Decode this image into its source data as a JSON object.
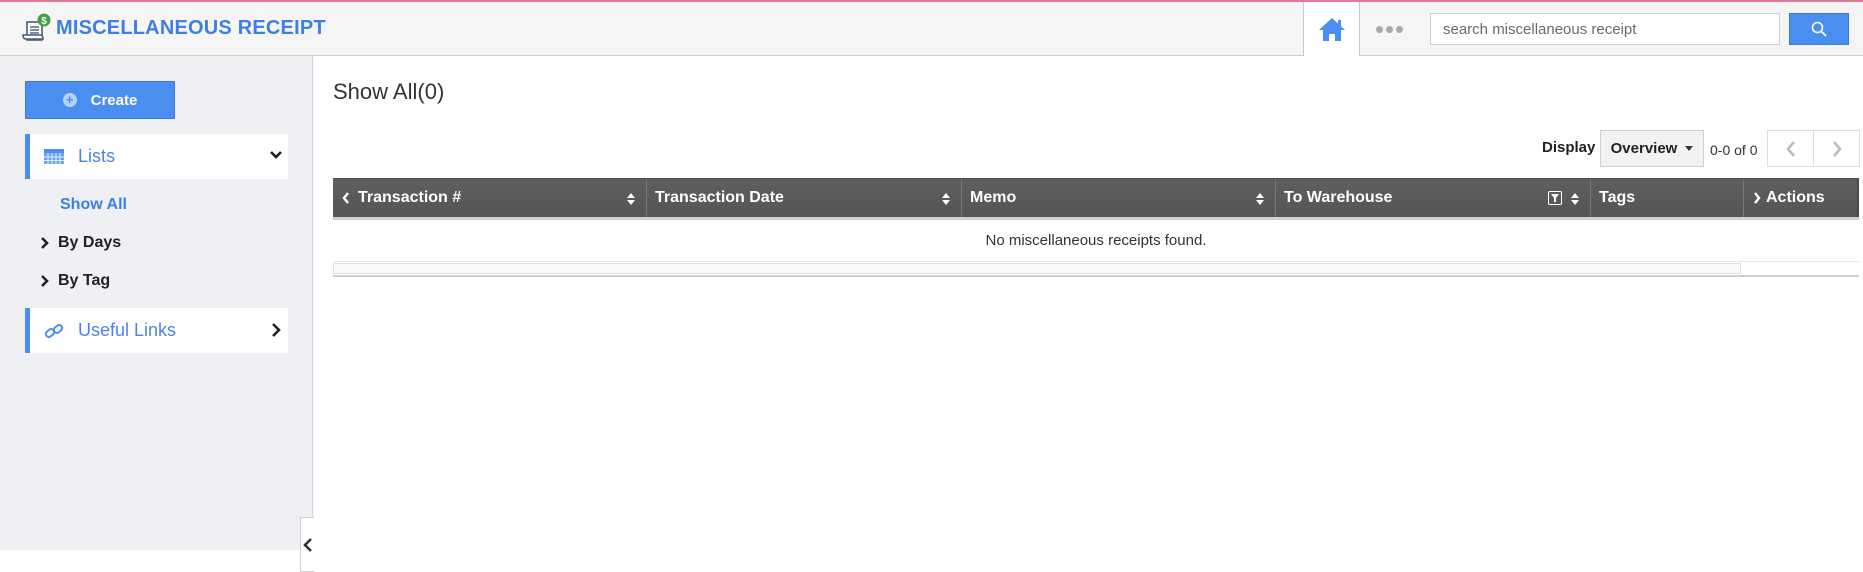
{
  "app": {
    "title": "MISCELLANEOUS RECEIPT",
    "accent_color": "#4a8ef0",
    "top_border_color": "#e07a95"
  },
  "header": {
    "search": {
      "placeholder": "search miscellaneous receipt",
      "value": ""
    },
    "icons": {
      "home": "home-icon",
      "more": "more-dots-icon",
      "search": "search-icon"
    }
  },
  "sidebar": {
    "create_label": "Create",
    "lists_label": "Lists",
    "items": [
      {
        "label": "Show All",
        "active": true
      },
      {
        "label": "By Days",
        "active": false
      },
      {
        "label": "By Tag",
        "active": false
      }
    ],
    "useful_links_label": "Useful Links"
  },
  "main": {
    "title": "Show All(0)",
    "display_label": "Display",
    "display_value": "Overview",
    "range_text": "0-0 of 0",
    "table": {
      "columns": [
        {
          "label": "Transaction #",
          "sortable": true
        },
        {
          "label": "Transaction Date",
          "sortable": true
        },
        {
          "label": "Memo",
          "sortable": true
        },
        {
          "label": "To Warehouse",
          "sortable": true,
          "filterable": true
        },
        {
          "label": "Tags",
          "sortable": false
        },
        {
          "label": "Actions",
          "sortable": false
        }
      ],
      "rows": [],
      "empty_message": "No miscellaneous receipts found."
    }
  }
}
